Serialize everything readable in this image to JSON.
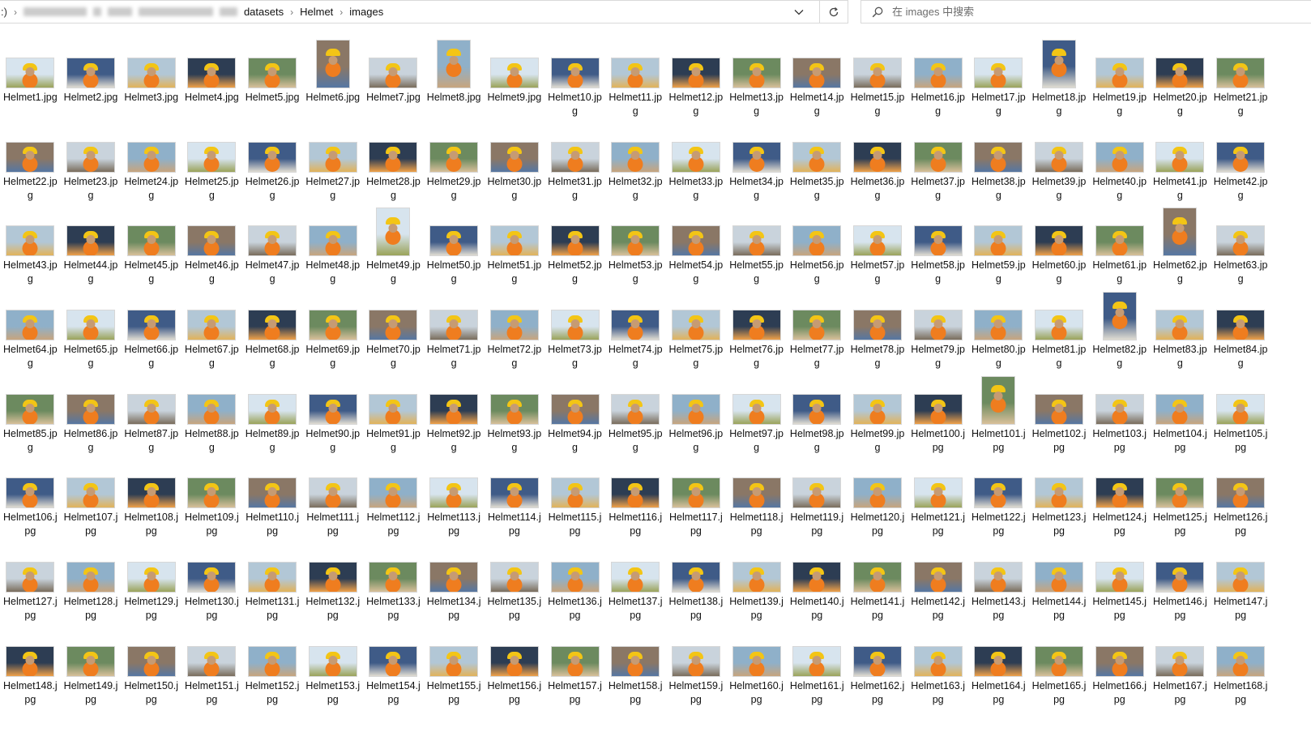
{
  "address": {
    "fragment": ":)",
    "crumbs": [
      "datasets",
      "Helmet",
      "images"
    ]
  },
  "icons": {
    "dropdown": "chevron-down-icon",
    "refresh": "refresh-icon",
    "search": "search-icon"
  },
  "search": {
    "placeholder": "在 images 中搜索"
  },
  "files": {
    "count": 168,
    "prefix": "Helmet",
    "extension": ".jpg"
  },
  "thumbnail_palettes": [
    [
      "#8fb0c9",
      "#c7a57e"
    ],
    [
      "#6c8a5f",
      "#d8c09a"
    ],
    [
      "#3f5b87",
      "#e0dcd2"
    ],
    [
      "#c9d3dc",
      "#7a6d5c"
    ],
    [
      "#2d3d53",
      "#f0a24a"
    ],
    [
      "#d7e4ee",
      "#9aa35a"
    ],
    [
      "#8a7766",
      "#5677a3"
    ],
    [
      "#b2c7d6",
      "#e2b35a"
    ]
  ]
}
